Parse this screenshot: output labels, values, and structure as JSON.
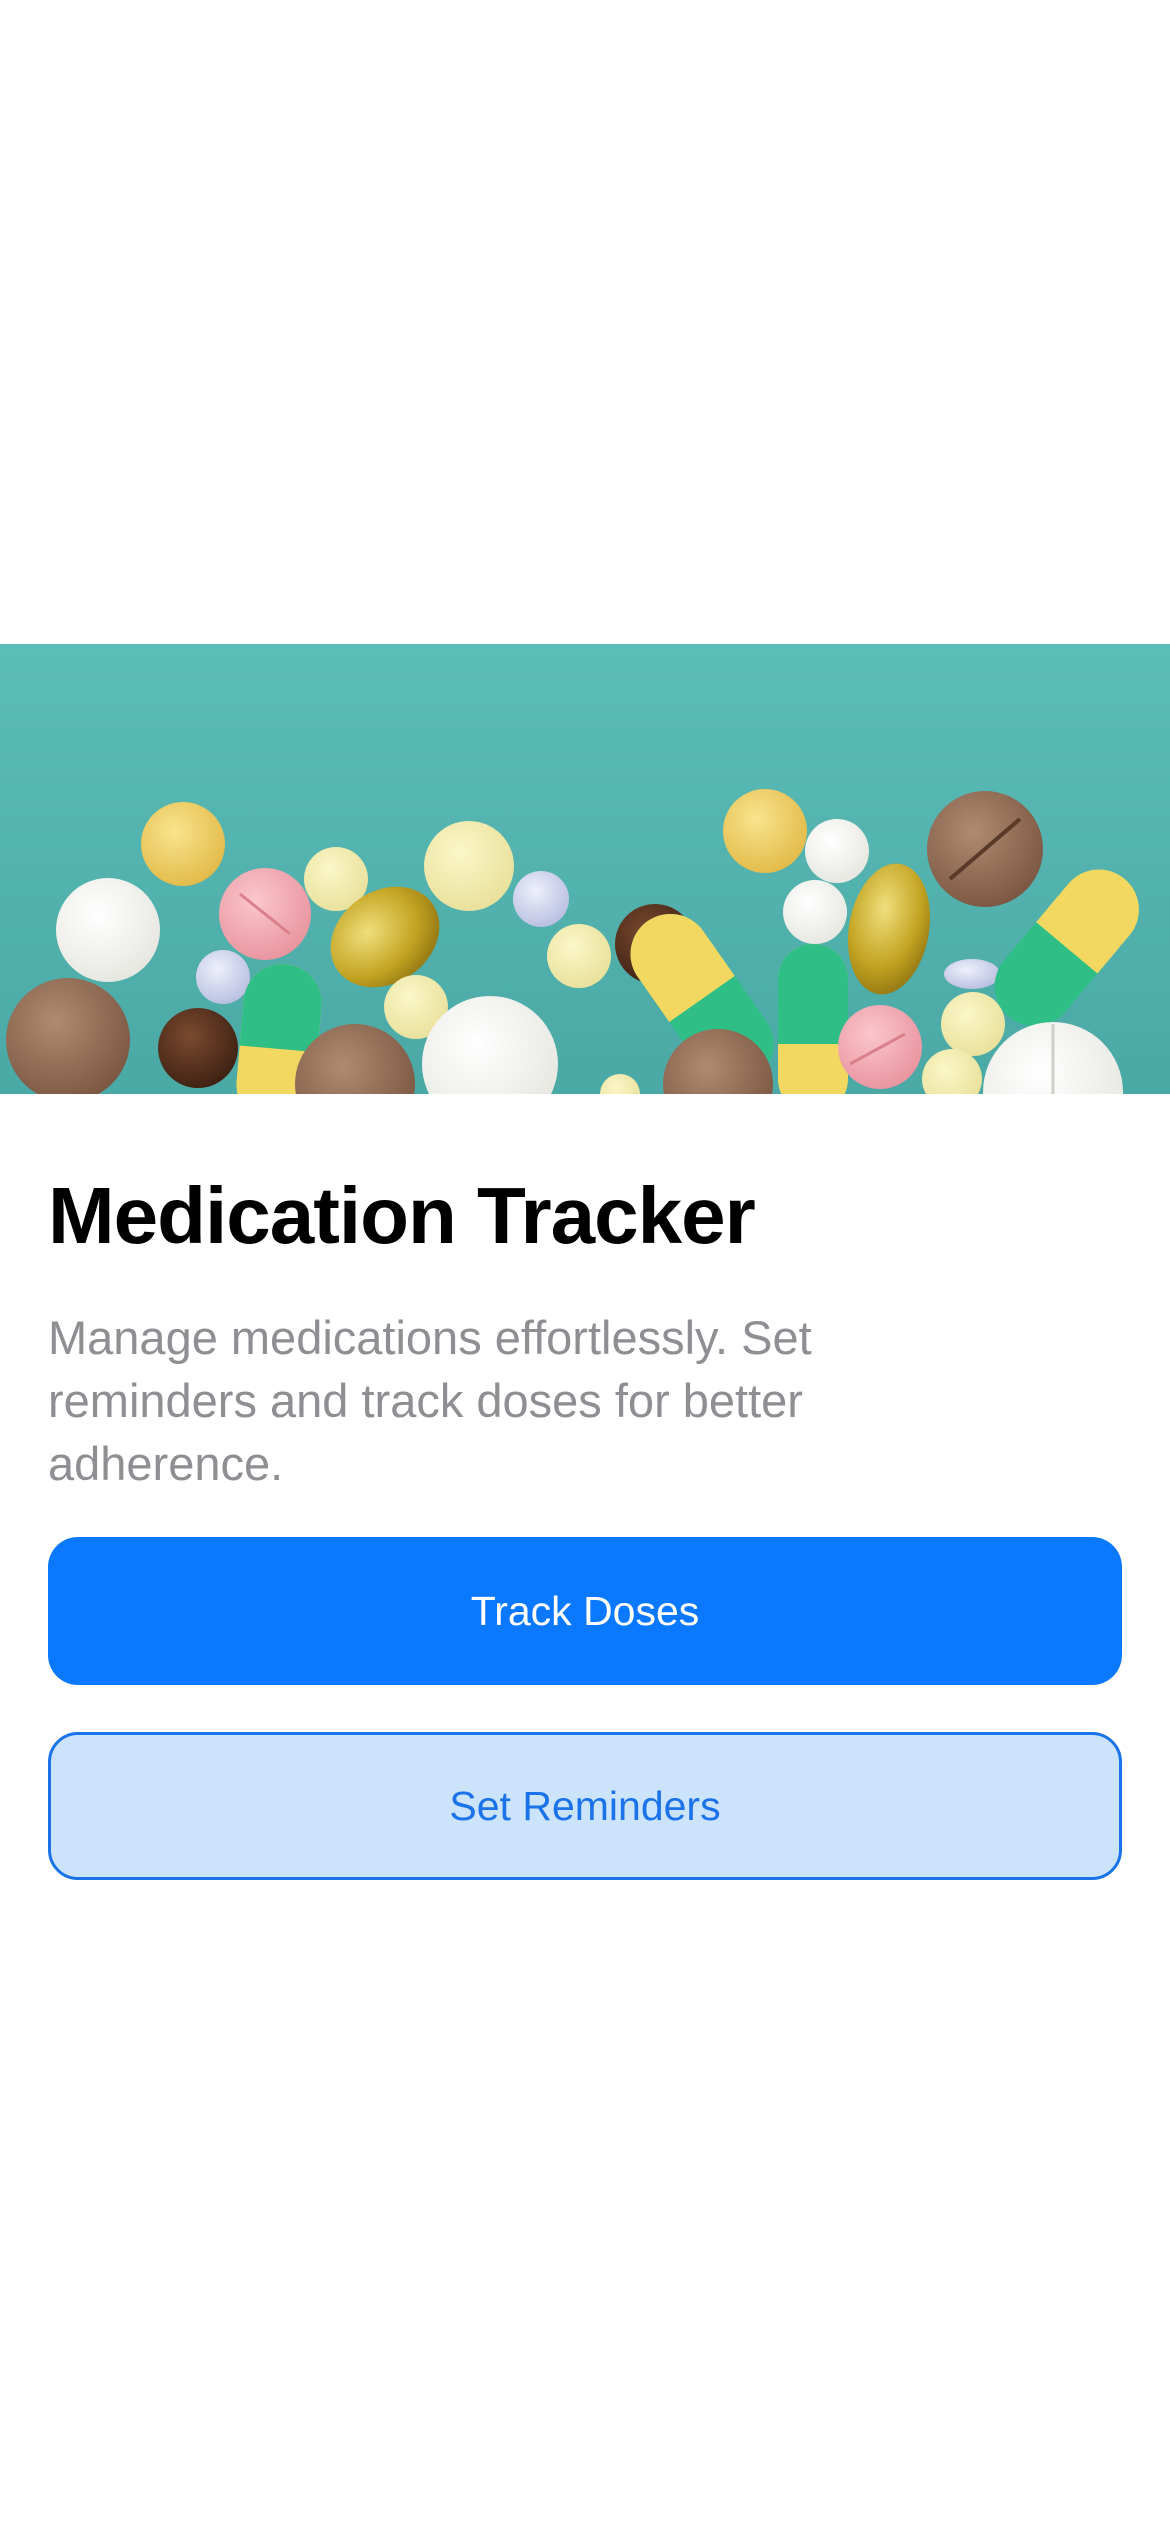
{
  "hero": {
    "image_name": "medication-pills-image",
    "background_color": "#57b7b2"
  },
  "main": {
    "title": "Medication Tracker",
    "subtitle": "Manage medications effortlessly. Set reminders and track doses for better adherence."
  },
  "buttons": {
    "primary_label": "Track Doses",
    "secondary_label": "Set Reminders"
  },
  "colors": {
    "accent": "#0a78ff",
    "secondary_bg": "#cce3fc",
    "secondary_text": "#1a73e8",
    "subtitle_text": "#8e8e93"
  }
}
